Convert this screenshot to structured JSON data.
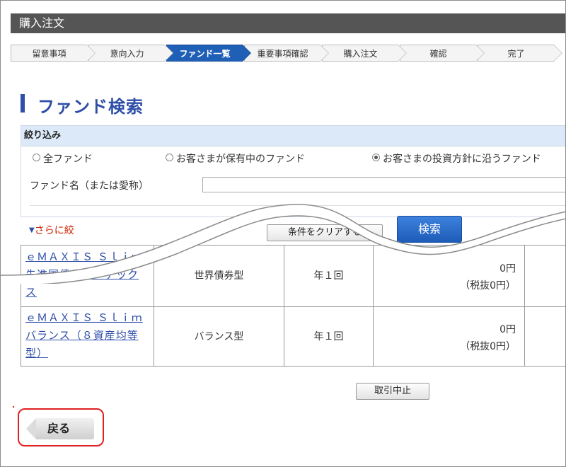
{
  "window": {
    "title": "購入注文"
  },
  "steps": [
    {
      "label": "留意事項",
      "active": false
    },
    {
      "label": "意向入力",
      "active": false
    },
    {
      "label": "ファンド一覧",
      "active": true
    },
    {
      "label": "重要事項確認",
      "active": false
    },
    {
      "label": "購入注文",
      "active": false
    },
    {
      "label": "確認",
      "active": false
    },
    {
      "label": "完了",
      "active": false
    }
  ],
  "page": {
    "heading": "ファンド検索"
  },
  "filter": {
    "header": "絞り込み",
    "radios": [
      {
        "label": "全ファンド",
        "checked": false
      },
      {
        "label": "お客さまが保有中のファンド",
        "checked": false
      },
      {
        "label": "お客さまの投資方針に沿うファンド",
        "checked": true
      }
    ],
    "fund_name_label": "ファンド名（または愛称）",
    "fund_name_value": "",
    "more_link": "さらに絞",
    "clear_button": "条件をクリアする",
    "search_button": "検索"
  },
  "results": {
    "rows": [
      {
        "name_lines": [
          "ｅＭＡＸＩＳ Ｓｌｉｍ",
          "先進国債券インデック",
          "ス"
        ],
        "type": "世界債券型",
        "frequency": "年１回",
        "fee": "0円",
        "fee_excl_tax": "（税抜0円）"
      },
      {
        "name_lines": [
          "ｅＭＡＸＩＳ Ｓｌｉｍ",
          "バランス（８資産均等",
          "型）"
        ],
        "type": "バランス型",
        "frequency": "年１回",
        "fee": "0円",
        "fee_excl_tax": "（税抜0円）"
      }
    ]
  },
  "actions": {
    "cancel_button": "取引中止",
    "back_button": "戻る"
  },
  "colors": {
    "active_step": "#1f5fb5",
    "heading": "#2e4ea8",
    "highlight": "#e02020"
  }
}
